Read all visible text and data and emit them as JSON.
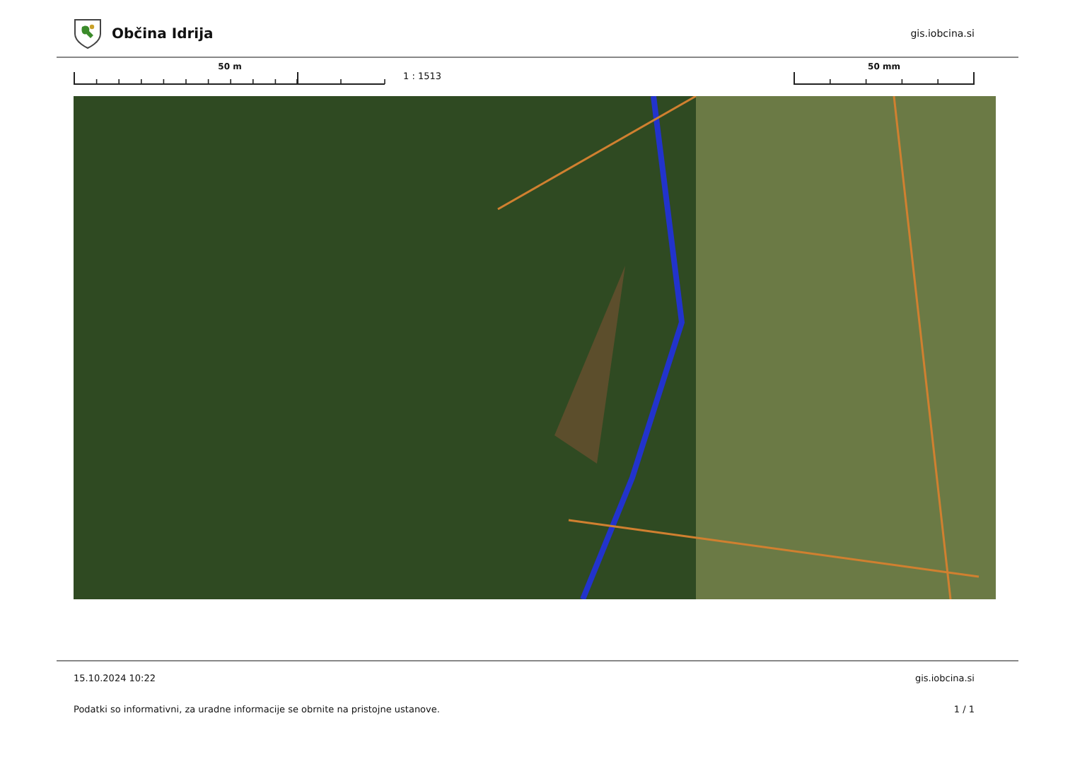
{
  "header": {
    "title": "Občina Idrija",
    "site": "gis.iobcina.si"
  },
  "scales": [
    {
      "kind": "ground",
      "label": "50 m",
      "ratio": "1 : 1513"
    },
    {
      "kind": "paper",
      "label": "50 mm"
    }
  ],
  "footer": {
    "timestamp": "15.10.2024 10:22",
    "site": "gis.iobcina.si",
    "disclaimer": "Podatki so informativni, za uradne informacije se obrnite na pristojne ustanove.",
    "page": "1 / 1"
  }
}
